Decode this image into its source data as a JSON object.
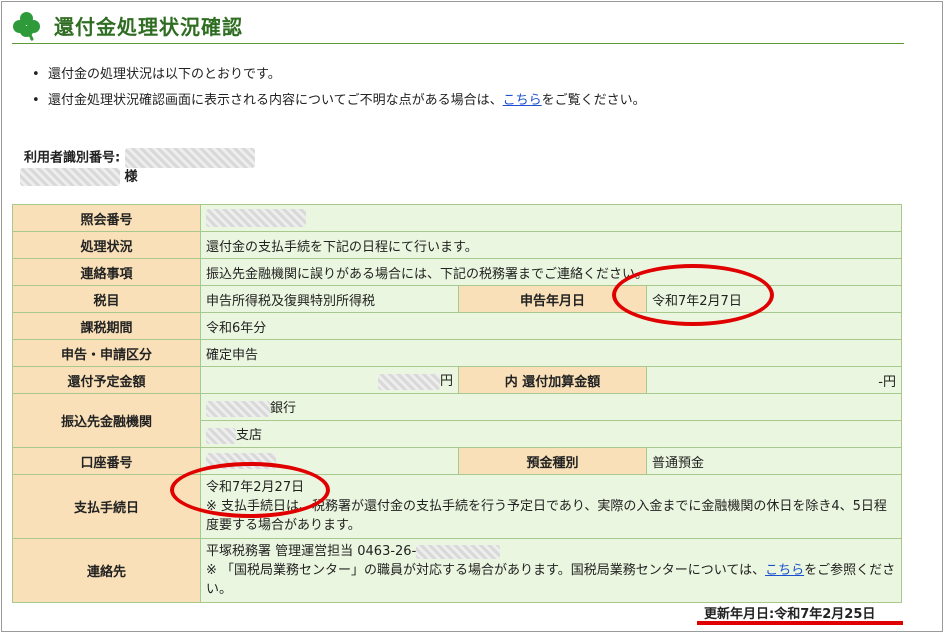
{
  "header": {
    "title": "還付金処理状況確認",
    "icon": "clover-icon"
  },
  "notes": {
    "line1": "還付金の処理状況は以下のとおりです。",
    "line2_before": "還付金処理状況確認画面に表示される内容についてご不明な点がある場合は、",
    "line2_link": "こちら",
    "line2_after": "をご覧ください。"
  },
  "user": {
    "id_label": "利用者識別番号:",
    "honorific": "様"
  },
  "table": {
    "inquiry_no_label": "照会番号",
    "status_label": "処理状況",
    "status_value": "還付金の支払手続を下記の日程にて行います。",
    "contact_note_label": "連絡事項",
    "contact_note_value": "振込先金融機関に誤りがある場合には、下記の税務署までご連絡ください。",
    "tax_item_label": "税目",
    "tax_item_value": "申告所得税及復興特別所得税",
    "filing_date_label": "申告年月日",
    "filing_date_value": "令和7年2月7日",
    "tax_period_label": "課税期間",
    "tax_period_value": "令和6年分",
    "category_label": "申告・申請区分",
    "category_value": "確定申告",
    "refund_amount_label": "還付予定金額",
    "refund_amount_unit": "円",
    "additional_label": "内 還付加算金額",
    "additional_value": "-円",
    "bank_label": "振込先金融機関",
    "bank_suffix": "銀行",
    "branch_suffix": "支店",
    "account_no_label": "口座番号",
    "deposit_type_label": "預金種別",
    "deposit_type_value": "普通預金",
    "payment_date_label": "支払手続日",
    "payment_date_value": "令和7年2月27日",
    "payment_note": "※ 支払手続日は、税務署が還付金の支払手続を行う予定日であり、実際の入金までに金融機関の休日を除き4、5日程度要する場合があります。",
    "contact_label": "連絡先",
    "contact_office": "平塚税務署 管理運営担当 0463-26-",
    "contact_note_before": "※ 「国税局業務センター」の職員が対応する場合があります。国税局業務センターについては、",
    "contact_note_link": "こちら",
    "contact_note_after": "をご参照ください。"
  },
  "footer": {
    "updated": "更新年月日:令和7年2月25日"
  },
  "colors": {
    "label_bg": "#f9e0b8",
    "value_bg": "#eaf6df",
    "title": "#2f6e22",
    "highlight": "#e00000"
  }
}
